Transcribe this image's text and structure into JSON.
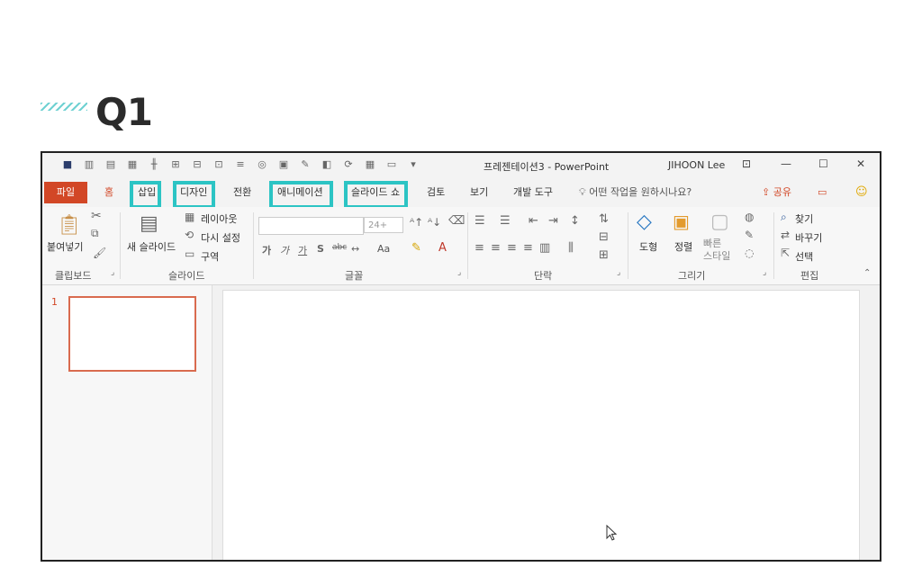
{
  "heading": {
    "title": "Q1"
  },
  "window": {
    "doc_title": "프레젠테이션3  -  PowerPoint",
    "user": "JIHOON Lee",
    "controls": {
      "minimize": "—",
      "maximize": "☐",
      "close": "✕",
      "ribbon_display": "⊡"
    }
  },
  "qat": {
    "customize": "▾"
  },
  "tabs": {
    "file": "파일",
    "home": "홈",
    "insert": "삽입",
    "design": "디자인",
    "transitions": "전환",
    "animations": "애니메이션",
    "slideshow": "슬라이드 쇼",
    "review": "검토",
    "view": "보기",
    "developer": "개발 도구",
    "tell_me": "어떤 작업을 원하시나요?",
    "share": "공유"
  },
  "ribbon": {
    "clipboard": {
      "label": "클립보드",
      "paste": "붙여넣기"
    },
    "slides": {
      "label": "슬라이드",
      "new_slide": "새 슬라이드",
      "layout": "레이아웃",
      "reset": "다시 설정",
      "section": "구역"
    },
    "font": {
      "label": "글꼴",
      "size": "24+",
      "aa": "Aa"
    },
    "paragraph": {
      "label": "단락"
    },
    "drawing": {
      "label": "그리기",
      "shapes": "도형",
      "arrange": "정렬",
      "quick_styles": "빠른\n스타일"
    },
    "editing": {
      "label": "편집",
      "find": "찾기",
      "replace": "바꾸기",
      "select": "선택"
    }
  },
  "slides_pane": {
    "slide_number": "1"
  },
  "highlight_color": "#2cc4c4",
  "accent_color": "#d24726"
}
